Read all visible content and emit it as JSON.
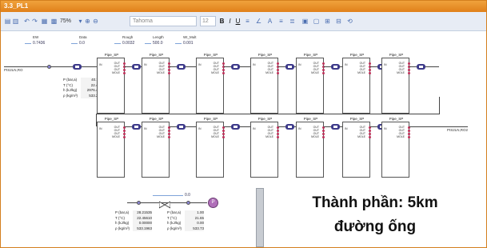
{
  "window": {
    "title": "3.3_PL1"
  },
  "toolbar": {
    "zoom": "75%",
    "font": "Tahoma",
    "size": "12"
  },
  "params": [
    {
      "label": "EW",
      "value": "0.7436"
    },
    {
      "label": "Data",
      "value": "0.0"
    },
    {
      "label": "Rough",
      "value": "0.0032"
    },
    {
      "label": "Length",
      "value": "500.0"
    },
    {
      "label": "WI_Mult",
      "value": "0.001"
    }
  ],
  "feed": {
    "in_label": "PIS2LN,RO",
    "out_label": "PIS2LN,RO2",
    "props": [
      {
        "k": "P (bar,a)",
        "v": "40.11"
      },
      {
        "k": "T (°C)",
        "v": "22.46"
      },
      {
        "k": "h (kJ/kg)",
        "v": "2976.43"
      },
      {
        "k": "ρ (kg/m³)",
        "v": "533.25"
      }
    ]
  },
  "pipes": {
    "title": "Pipe_SP",
    "in": "IN",
    "out": [
      "OUT",
      "OUT",
      "OUT",
      "MOLE"
    ]
  },
  "bottom": {
    "slider_value": "0.0",
    "left_table": [
      {
        "k": "P (bar,a)",
        "v": "28.21535"
      },
      {
        "k": "T (°C)",
        "v": "22.45610"
      },
      {
        "k": "h (kJ/kg)",
        "v": "0.00000"
      },
      {
        "k": "ρ (kg/m³)",
        "v": "533.1963"
      }
    ],
    "right_table": [
      {
        "k": "P (bar,a)",
        "v": "1.00"
      },
      {
        "k": "T (°C)",
        "v": "21.65"
      },
      {
        "k": "h (kJ/kg)",
        "v": "0.00"
      },
      {
        "k": "ρ (kg/m³)",
        "v": "533.73"
      }
    ],
    "pump_label": "P"
  },
  "caption": {
    "line1": "Thành phần: 5km",
    "line2": "đường ống"
  }
}
